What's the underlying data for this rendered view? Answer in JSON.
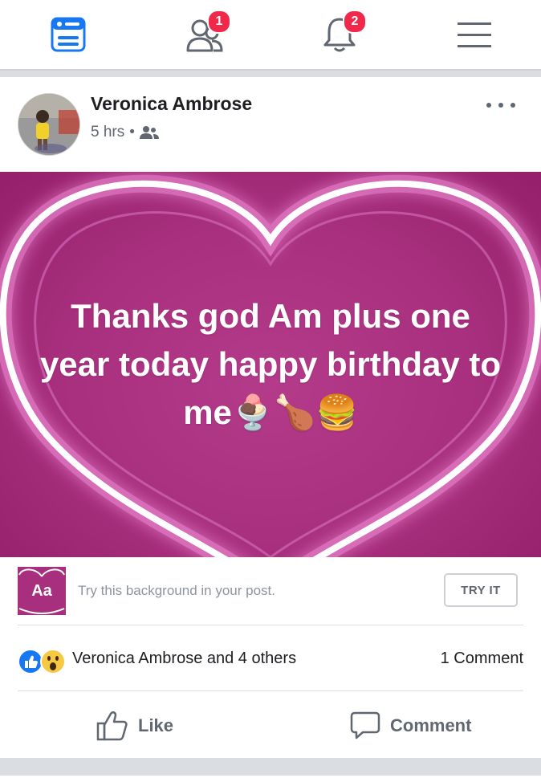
{
  "nav": {
    "items": [
      {
        "icon": "news-feed-icon",
        "active": true
      },
      {
        "icon": "friends-icon",
        "badge": "1"
      },
      {
        "icon": "notifications-bell-icon",
        "badge": "2"
      },
      {
        "icon": "menu-icon"
      }
    ],
    "accent": "#1877f2",
    "badge_color": "#f02849"
  },
  "post": {
    "author": "Veronica Ambrose",
    "time": "5 hrs",
    "separator": "•",
    "audience_icon": "friends-audience-icon",
    "text": "Thanks god Am plus one year today happy birthday to me🍨🍗🍔",
    "background_color": "#a72f7d"
  },
  "try_background": {
    "thumb_label": "Aa",
    "label": "Try this background in your post.",
    "button": "TRY IT"
  },
  "reactions": {
    "icons": [
      "like-reaction-icon",
      "wow-reaction-icon"
    ],
    "names": "Veronica Ambrose and 4 others",
    "comments": "1 Comment"
  },
  "actions": {
    "like": "Like",
    "comment": "Comment"
  }
}
